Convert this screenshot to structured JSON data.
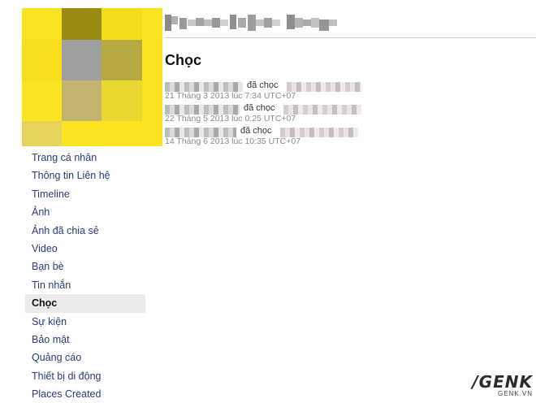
{
  "page": {
    "title": "Chọc"
  },
  "avatar_palette": [
    "#f9e21f",
    "#9c8b12",
    "#f3dc18",
    "#fbe523",
    "#f6df1a",
    "#9f9f9f",
    "#b7aa45",
    "#fbe322",
    "#fbe322",
    "#c1b46e",
    "#e9d72f",
    "#fbe322",
    "#e7d35b",
    "#f9e21f",
    "#fbe322",
    "#fbe322"
  ],
  "pokes": [
    {
      "verb": "đã chọc",
      "time": "21 Tháng 3 2013 lúc 7:34 UTC+07"
    },
    {
      "verb": "đã chọc",
      "time": "22 Tháng 5 2013 lúc 0:25 UTC+07"
    },
    {
      "verb": "đã chọc",
      "time": "14 Tháng 6 2013 lúc 10:35 UTC+07"
    }
  ],
  "sidebar": {
    "items": [
      {
        "label": "Trang cá nhân"
      },
      {
        "label": "Thông tin Liên hệ"
      },
      {
        "label": "Timeline"
      },
      {
        "label": "Ảnh"
      },
      {
        "label": "Ảnh đã chia sẻ"
      },
      {
        "label": "Video"
      },
      {
        "label": "Bạn bè"
      },
      {
        "label": "Tin nhắn"
      },
      {
        "label": "Chọc",
        "active": true
      },
      {
        "label": "Sự kiện"
      },
      {
        "label": "Bảo mật"
      },
      {
        "label": "Quảng cáo"
      },
      {
        "label": "Thiết bị di động"
      },
      {
        "label": "Places Created"
      }
    ]
  },
  "watermark": {
    "logo": "/GENK",
    "sub": "GENK.VN"
  }
}
